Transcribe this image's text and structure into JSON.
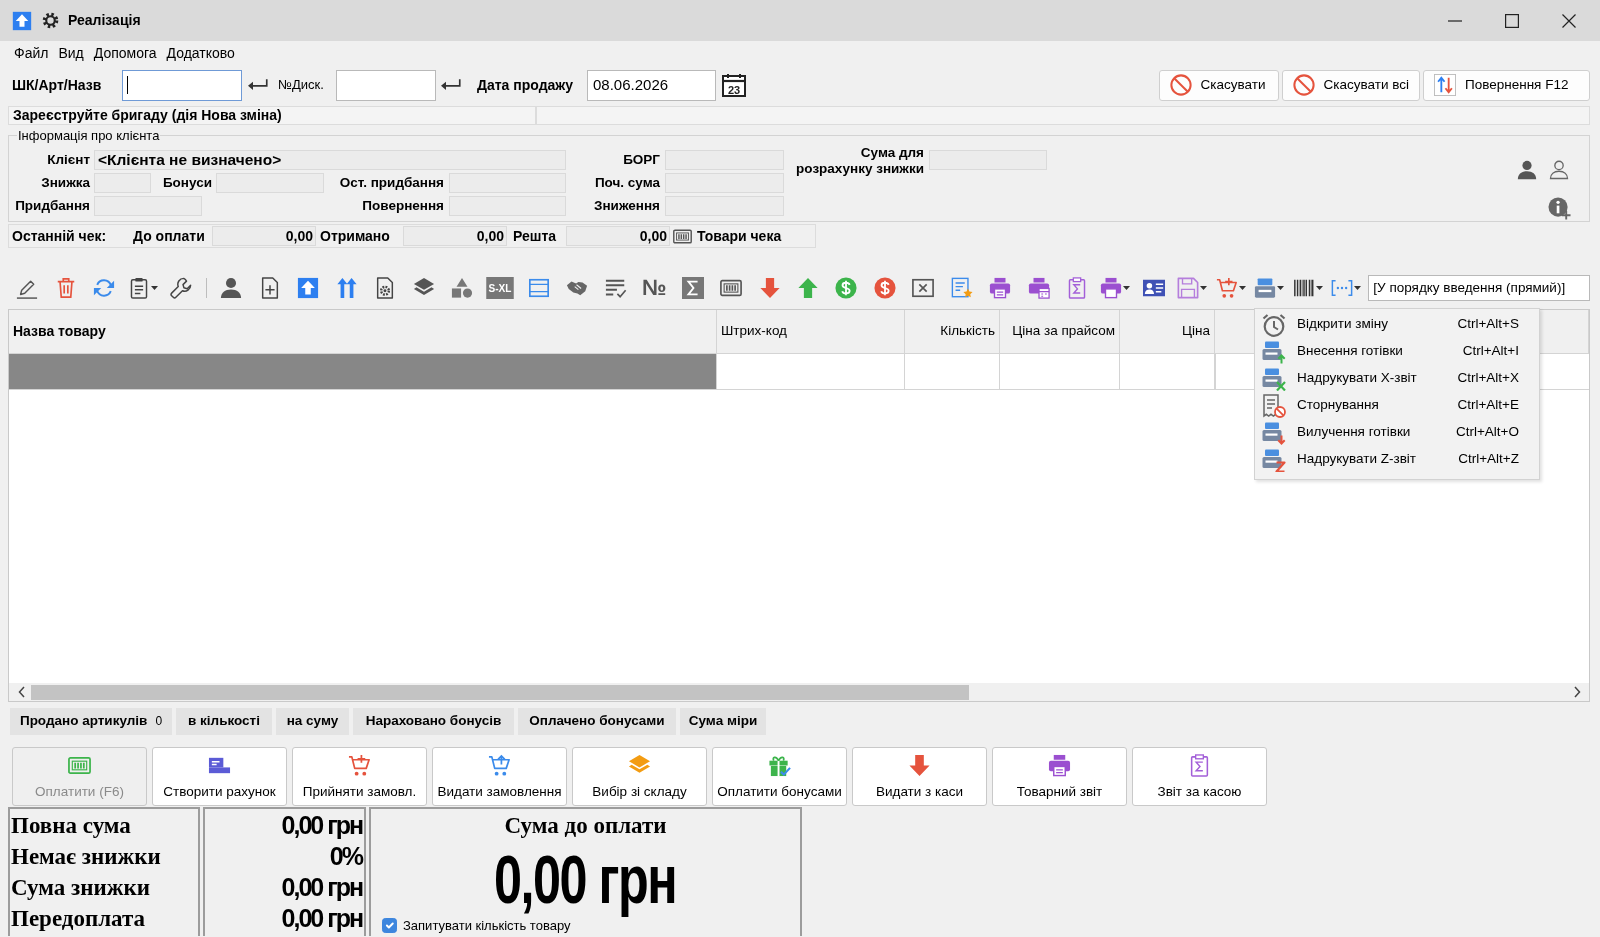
{
  "window": {
    "title": "Реалізація"
  },
  "menu": [
    "Файл",
    "Вид",
    "Допомога",
    "Додатково"
  ],
  "search": {
    "code": {
      "label": "ШК/Арт/Назв",
      "focused": true
    },
    "card": {
      "label": "№Диск."
    },
    "date": {
      "label": "Дата продажу",
      "value": "08.06.2026",
      "calendar_day": "23"
    }
  },
  "actions": [
    {
      "kind": "cancel",
      "label": "Скасувати"
    },
    {
      "kind": "cancel-all",
      "label": "Скасувати всі"
    },
    {
      "kind": "return",
      "label": "Повернення F12"
    }
  ],
  "status": {
    "message": "Зареєструйте бригаду (дія Нова зміна)"
  },
  "client_info": {
    "title": "Інформація про клієнта",
    "client": {
      "label": "Клієнт",
      "value": "<Клієнта не визначено>"
    },
    "discount": {
      "label": "Знижка"
    },
    "bonuses": {
      "label": "Бонуси"
    },
    "remaining_purchases": {
      "label": "Ост. придбання"
    },
    "purchases": {
      "label": "Придбання"
    },
    "returns": {
      "label": "Повернення"
    },
    "debt": {
      "label": "БОРГ"
    },
    "initial_sum": {
      "label": "Поч. сума"
    },
    "reductions": {
      "label": "Зниження"
    },
    "discount_base": {
      "label": "Сума для розрахунку знижки"
    }
  },
  "last_receipt": {
    "title": "Останній чек:",
    "fields": [
      {
        "label": "До оплати",
        "value": "0,00"
      },
      {
        "label": "Отримано",
        "value": "0,00"
      },
      {
        "label": "Решта",
        "value": "0,00"
      }
    ],
    "items_button": "Товари чека"
  },
  "toolbar": {
    "size_tag": "S-XL",
    "number_sign": "№",
    "sort_order": "[У порядку введення (прямий)]"
  },
  "table": {
    "columns": [
      "Назва товару",
      "Штрих-код",
      "Кількість",
      "Ціна за прайсом",
      "Ціна"
    ],
    "rows": [
      {
        "selected": true
      }
    ]
  },
  "cash_menu": [
    {
      "kind": "open-shift",
      "label": "Відкрити зміну",
      "shortcut": "Ctrl+Alt+S"
    },
    {
      "kind": "cash-in",
      "label": "Внесення готівки",
      "shortcut": "Ctrl+Alt+I"
    },
    {
      "kind": "x-report",
      "label": "Надрукувати X-звіт",
      "shortcut": "Ctrl+Alt+X"
    },
    {
      "kind": "storno",
      "label": "Сторнування",
      "shortcut": "Ctrl+Alt+E"
    },
    {
      "kind": "cash-out",
      "label": "Вилучення готівки",
      "shortcut": "Ctrl+Alt+O"
    },
    {
      "kind": "z-report",
      "label": "Надрукувати Z-звіт",
      "shortcut": "Ctrl+Alt+Z"
    }
  ],
  "stats": [
    {
      "label": "Продано артикулів",
      "value": "0"
    },
    {
      "label": "в кількості"
    },
    {
      "label": "на суму"
    },
    {
      "label": "Нараховано бонусів"
    },
    {
      "label": "Оплачено бонусами"
    },
    {
      "label": "Сума міри"
    }
  ],
  "buttons": [
    {
      "kind": "pay",
      "label": "Оплатити (F6)",
      "disabled": true
    },
    {
      "kind": "invoice",
      "label": "Створити рахунок",
      "disabled": false
    },
    {
      "kind": "accept-order",
      "label": "Прийняти замовл.",
      "disabled": false
    },
    {
      "kind": "issue-order",
      "label": "Видати замовлення",
      "disabled": false
    },
    {
      "kind": "warehouse",
      "label": "Вибір зі складу",
      "disabled": false
    },
    {
      "kind": "bonus-pay",
      "label": "Оплатити бонусами",
      "disabled": false
    },
    {
      "kind": "cash-out",
      "label": "Видати з каси",
      "disabled": false
    },
    {
      "kind": "goods-report",
      "label": "Товарний звіт",
      "disabled": false
    },
    {
      "kind": "cash-report",
      "label": "Звіт за касою",
      "disabled": false
    }
  ],
  "totals": {
    "rows": [
      {
        "label": "Повна сума",
        "value": "0,00 грн"
      },
      {
        "label": "Немає знижки",
        "value": "0%"
      },
      {
        "label": "Сума знижки",
        "value": "0,00 грн"
      },
      {
        "label": "Передоплата",
        "value": "0,00 грн"
      }
    ],
    "due_title": "Сума до оплати",
    "due_value": "0,00 грн",
    "ask_quantity": {
      "label": "Запитувати кількість товару",
      "checked": true
    }
  }
}
